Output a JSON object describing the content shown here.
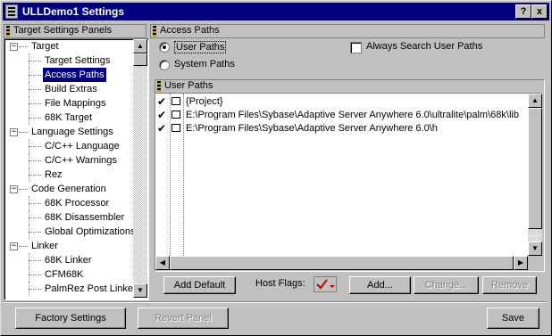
{
  "window": {
    "title": "ULLDemo1 Settings",
    "help_button": "?",
    "close_button": "x"
  },
  "left_panel": {
    "header": "Target Settings Panels",
    "tree": [
      {
        "label": "Target",
        "level": 0,
        "expanded": true
      },
      {
        "label": "Target Settings",
        "level": 1
      },
      {
        "label": "Access Paths",
        "level": 1,
        "selected": true
      },
      {
        "label": "Build Extras",
        "level": 1
      },
      {
        "label": "File Mappings",
        "level": 1
      },
      {
        "label": "68K Target",
        "level": 1
      },
      {
        "label": "Language Settings",
        "level": 0,
        "expanded": true
      },
      {
        "label": "C/C++ Language",
        "level": 1
      },
      {
        "label": "C/C++ Warnings",
        "level": 1
      },
      {
        "label": "Rez",
        "level": 1
      },
      {
        "label": "Code Generation",
        "level": 0,
        "expanded": true
      },
      {
        "label": "68K Processor",
        "level": 1
      },
      {
        "label": "68K Disassembler",
        "level": 1
      },
      {
        "label": "Global Optimizations",
        "level": 1
      },
      {
        "label": "Linker",
        "level": 0,
        "expanded": true
      },
      {
        "label": "68K Linker",
        "level": 1
      },
      {
        "label": "CFM68K",
        "level": 1
      },
      {
        "label": "PalmRez Post Linker",
        "level": 1
      }
    ]
  },
  "right_panel": {
    "header": "Access Paths",
    "radio_user_paths": "User Paths",
    "radio_system_paths": "System Paths",
    "selected_radio": "User Paths",
    "checkbox_always_search": "Always Search User Paths",
    "checkbox_checked": false,
    "list_header": "User Paths",
    "paths": [
      {
        "checked": true,
        "path": "{Project}"
      },
      {
        "checked": true,
        "path": "E:\\Program Files\\Sybase\\Adaptive Server Anywhere 6.0\\ultralite\\palm\\68k\\lib"
      },
      {
        "checked": true,
        "path": "E:\\Program Files\\Sybase\\Adaptive Server Anywhere 6.0\\h"
      }
    ],
    "buttons": {
      "add_default": "Add Default",
      "host_flags_label": "Host Flags:",
      "add": "Add...",
      "change": "Change...",
      "remove": "Remove"
    }
  },
  "footer": {
    "factory_settings": "Factory Settings",
    "revert_panel": "Revert Panel",
    "save": "Save"
  },
  "colors": {
    "title_bar": "#000080",
    "selection": "#000080",
    "face": "#c0c0c0"
  }
}
